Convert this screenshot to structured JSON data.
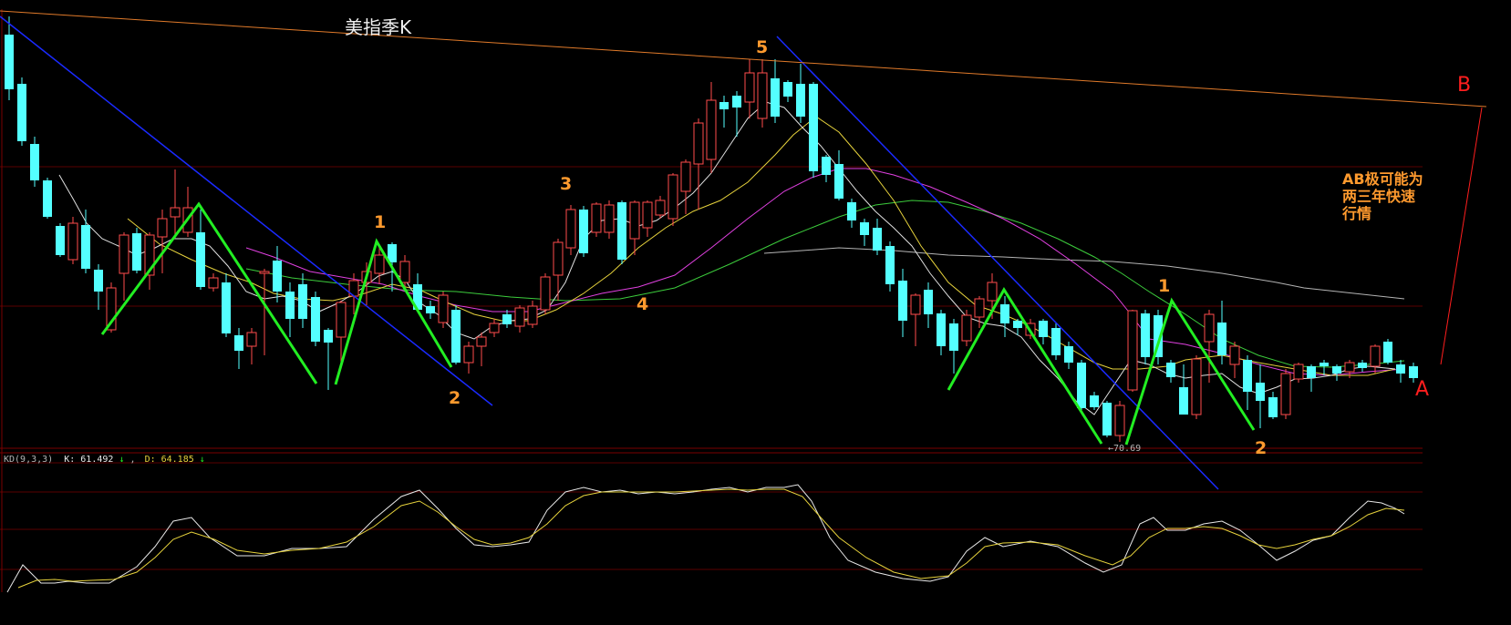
{
  "chart_data": {
    "type": "candlestick",
    "title": "美指季K",
    "grid": true,
    "colors": {
      "background": "#000000",
      "up_candle": "#ff4d4d",
      "down_candle": "#54ffff",
      "ma_white": "#e0e0e0",
      "ma_yellow": "#e6d23c",
      "ma_magenta": "#e040e0",
      "ma_green": "#3ccc3c",
      "ma_gray": "#b4b4b4",
      "trendline_blue": "#1a2aff",
      "trendline_orange": "#e07a2a",
      "wave_green": "#22ee22",
      "annotation_orange": "#ff9a2e",
      "annotation_red": "#ff1e1e",
      "grid_red": "#5a0000",
      "kd_k": "#e8e8e8",
      "kd_d": "#e6d23c"
    },
    "wave_labels": [
      "5",
      "3",
      "1",
      "4",
      "2",
      "1",
      "2"
    ],
    "points": {
      "A": "A",
      "B": "B"
    },
    "annotation_text": [
      "AB极可能为",
      "两三年快速",
      "行情"
    ],
    "low_marker": "←70.69",
    "indicator": {
      "name": "KD(9,3,3)",
      "k_label": "K: 61.492",
      "k_arrow": "↓",
      "d_label": "D: 64.185",
      "d_arrow": "↓"
    }
  }
}
